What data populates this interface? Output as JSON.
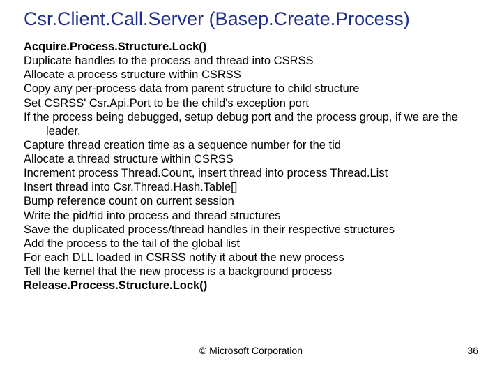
{
  "title": "Csr.Client.Call.Server (Basep.Create.Process)",
  "lines": {
    "l0": "Acquire.Process.Structure.Lock()",
    "l1": "Duplicate handles to the process and thread into CSRSS",
    "l2": "Allocate a process structure within CSRSS",
    "l3": "Copy any per-process data from parent structure to child structure",
    "l4": "Set CSRSS' Csr.Api.Port to be the child's exception port",
    "l5": "If the process being debugged, setup debug port and the process group, if we are the leader.",
    "l6": "Capture thread creation time as a sequence number for the tid",
    "l7": "Allocate a thread structure within CSRSS",
    "l8": "Increment process Thread.Count, insert thread into process Thread.List",
    "l9": "Insert thread into Csr.Thread.Hash.Table[]",
    "l10": "Bump reference count on current session",
    "l11": "Write the pid/tid into process and thread structures",
    "l12": "Save the duplicated process/thread handles in their respective structures",
    "l13": "Add the process to the tail of the global list",
    "l14": "For each DLL loaded in CSRSS notify it about the new process",
    "l15": "Tell the kernel that the new process is a background process",
    "l16": "Release.Process.Structure.Lock()"
  },
  "footer": "© Microsoft Corporation",
  "page": "36"
}
